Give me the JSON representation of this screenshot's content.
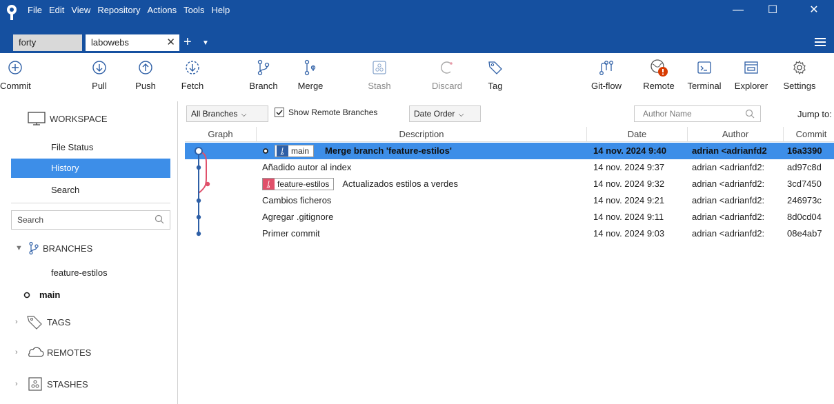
{
  "menu": [
    "File",
    "Edit",
    "View",
    "Repository",
    "Actions",
    "Tools",
    "Help"
  ],
  "window_controls": {
    "minimize": "—",
    "maximize": "☐",
    "close": "✕"
  },
  "tabs": [
    {
      "label": "forty"
    },
    {
      "label": "labowebs",
      "close": "✕"
    }
  ],
  "tab_add": "+",
  "tab_dropdown": "▼",
  "toolbar": {
    "commit": "Commit",
    "pull": "Pull",
    "push": "Push",
    "fetch": "Fetch",
    "branch": "Branch",
    "merge": "Merge",
    "stash": "Stash",
    "discard": "Discard",
    "tag": "Tag",
    "gitflow": "Git-flow",
    "remote": "Remote",
    "terminal": "Terminal",
    "explorer": "Explorer",
    "settings": "Settings"
  },
  "sidebar": {
    "workspace": "WORKSPACE",
    "file_status": "File Status",
    "history": "History",
    "search": "Search",
    "search_placeholder": "Search",
    "branches": "BRANCHES",
    "branch_items": [
      "feature-estilos",
      "main"
    ],
    "tags": "TAGS",
    "remotes": "REMOTES",
    "stashes": "STASHES"
  },
  "filter": {
    "branches": "All Branches",
    "show_remote": "Show Remote Branches",
    "order": "Date Order",
    "author_placeholder": "Author Name",
    "jump": "Jump to:"
  },
  "columns": {
    "graph": "Graph",
    "description": "Description",
    "date": "Date",
    "author": "Author",
    "commit": "Commit"
  },
  "commits": [
    {
      "branch_label": "main",
      "description": "Merge branch 'feature-estilos'",
      "date": "14 nov. 2024 9:40",
      "author": "adrian <adrianfd2",
      "commit": "16a3390"
    },
    {
      "description": "Añadido autor al index",
      "date": "14 nov. 2024 9:37",
      "author": "adrian <adrianfd2:",
      "commit": "ad97c8d"
    },
    {
      "branch_label": "feature-estilos",
      "description": "Actualizados estilos a verdes",
      "date": "14 nov. 2024 9:32",
      "author": "adrian <adrianfd2:",
      "commit": "3cd7450"
    },
    {
      "description": "Cambios ficheros",
      "date": "14 nov. 2024 9:21",
      "author": "adrian <adrianfd2:",
      "commit": "246973c"
    },
    {
      "description": "Agregar .gitignore",
      "date": "14 nov. 2024 9:11",
      "author": "adrian <adrianfd2:",
      "commit": "8d0cd04"
    },
    {
      "description": "Primer commit",
      "date": "14 nov. 2024 9:03",
      "author": "adrian <adrianfd2:",
      "commit": "08e4ab7"
    }
  ],
  "colors": {
    "titlebar": "#1550a0",
    "selection": "#3d8ee8",
    "main_line": "#2e5fa6",
    "feature_line": "#e0506a",
    "remote_badge": "#d83b01"
  }
}
